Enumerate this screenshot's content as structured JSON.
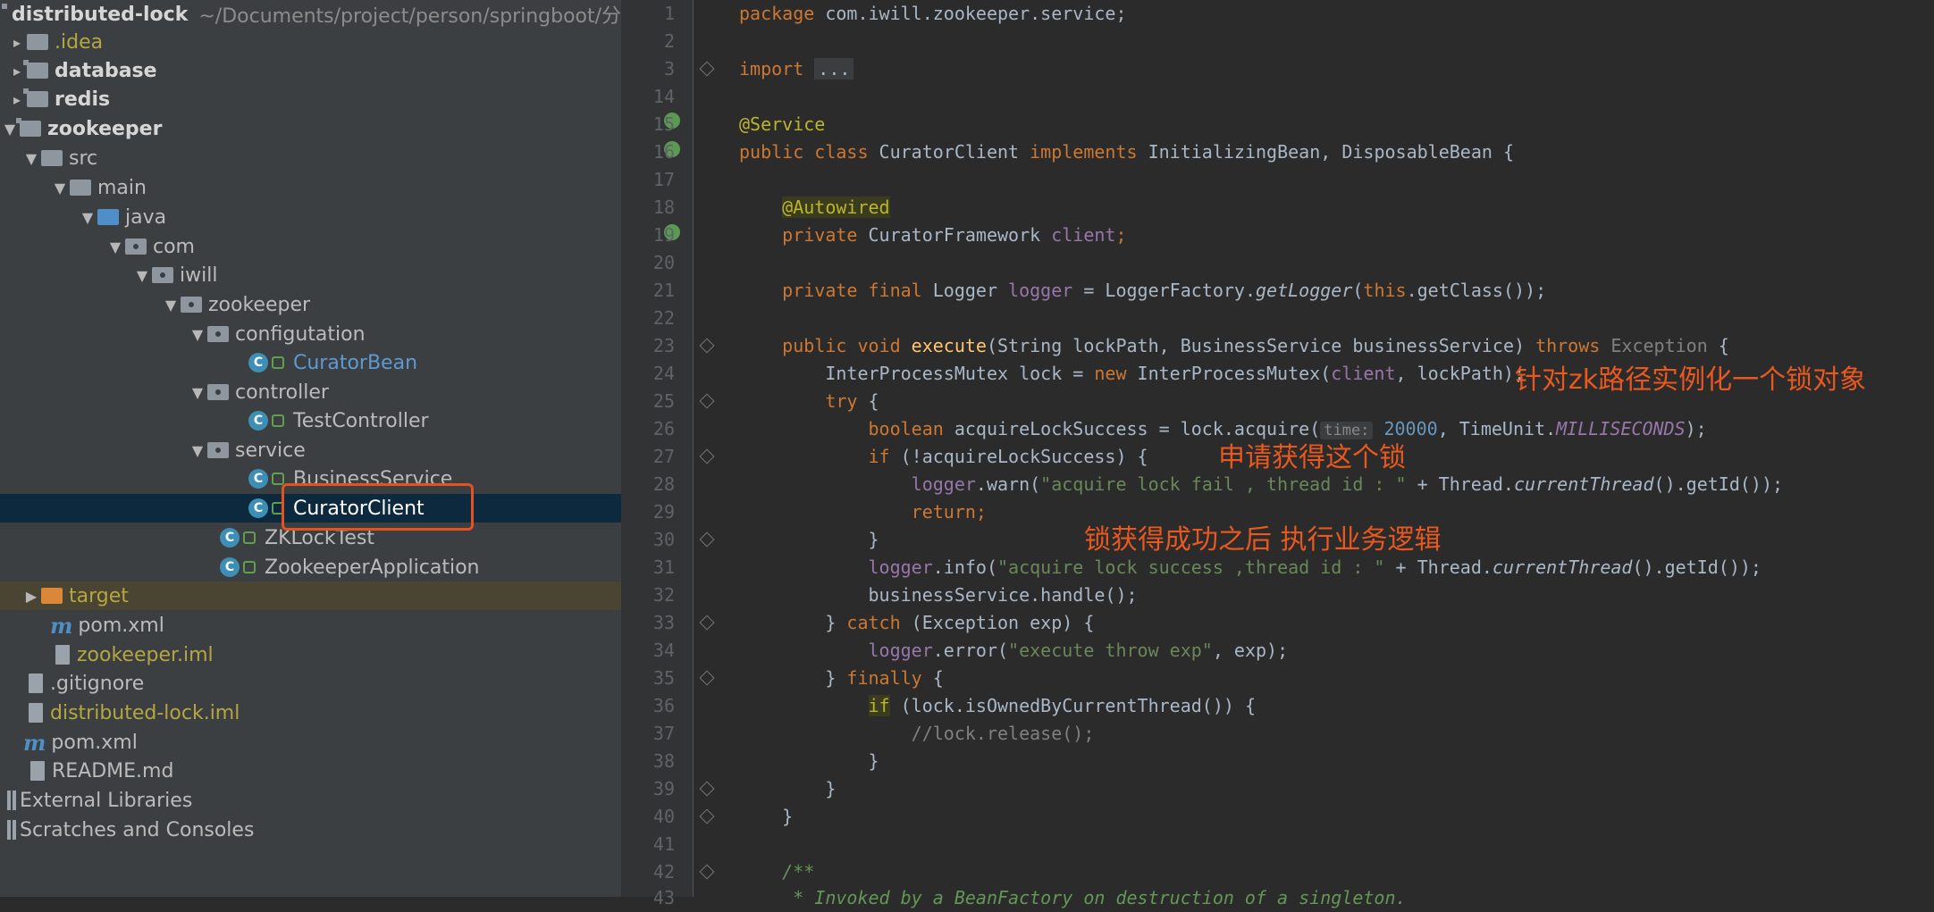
{
  "project": {
    "root_name": "distributed-lock",
    "root_path": "~/Documents/project/person/springboot/分布",
    "items": {
      "idea": ".idea",
      "database": "database",
      "redis": "redis",
      "zookeeper": "zookeeper",
      "src": "src",
      "main": "main",
      "java": "java",
      "com": "com",
      "iwill": "iwill",
      "zookeeper_pkg": "zookeeper",
      "configutation": "configutation",
      "curator_bean": "CuratorBean",
      "controller": "controller",
      "test_controller": "TestController",
      "service": "service",
      "business_service": "BusinessService",
      "curator_client": "CuratorClient",
      "zk_lock_test": "ZKLockTest",
      "zookeeper_application": "ZookeeperApplication",
      "target": "target",
      "pom_module": "pom.xml",
      "zookeeper_iml": "zookeeper.iml",
      "gitignore": ".gitignore",
      "distributed_iml": "distributed-lock.iml",
      "pom_root": "pom.xml",
      "readme": "README.md",
      "external_libraries": "External Libraries",
      "scratches": "Scratches and Consoles"
    }
  },
  "editor": {
    "line_numbers": [
      "1",
      "2",
      "3",
      "14",
      "15",
      "16",
      "17",
      "18",
      "19",
      "20",
      "21",
      "22",
      "23",
      "24",
      "25",
      "26",
      "27",
      "28",
      "29",
      "30",
      "31",
      "32",
      "33",
      "34",
      "35",
      "36",
      "37",
      "38",
      "39",
      "40",
      "41",
      "42",
      "43"
    ],
    "code": {
      "l1_kw": "package",
      "l1_rest": " com.iwill.zookeeper.service;",
      "l3_kw": "import",
      "l3_fold": "...",
      "l15": "@Service",
      "l16_kw1": "public class",
      "l16_name": "CuratorClient",
      "l16_kw2": "implements",
      "l16_rest": " InitializingBean, DisposableBean {",
      "l18": "@Autowired",
      "l19_kw": "private",
      "l19_type": " CuratorFramework ",
      "l19_field": "client",
      "l19_end": ";",
      "l21_kw": "private final",
      "l21_type": " Logger ",
      "l21_field": "logger",
      "l21_mid": " = LoggerFactory.",
      "l21_call": "getLogger",
      "l21_open": "(",
      "l21_this": "this",
      "l21_end": ".getClass());",
      "l23_kw": "public void",
      "l23_mth": "execute",
      "l23_params": "(String lockPath, BusinessService businessService) ",
      "l23_throws": "throws",
      "l23_exc": "Exception",
      "l23_end": " {",
      "l24_a": "InterProcessMutex lock = ",
      "l24_new": "new",
      "l24_b": " InterProcessMutex(",
      "l24_client": "client",
      "l24_c": ", lockPath);",
      "l25_kw": "try",
      "l25_end": " {",
      "l26_kw": "boolean",
      "l26_a": " acquireLockSuccess = lock.acquire(",
      "l26_hint": "time:",
      "l26_num": "20000",
      "l26_b": ", TimeUnit.",
      "l26_const": "MILLISECONDS",
      "l26_end": ");",
      "l27_kw": "if",
      "l27_rest": " (!acquireLockSuccess) {",
      "l28_field": "logger",
      "l28_a": ".warn(",
      "l28_str": "\"acquire lock fail , thread id : \"",
      "l28_b": " + Thread.",
      "l28_call": "currentThread",
      "l28_end": "().getId());",
      "l29_kw": "return",
      "l29_end": ";",
      "l30": "}",
      "l31_field": "logger",
      "l31_a": ".info(",
      "l31_str": "\"acquire lock success ,thread id : \"",
      "l31_b": " + Thread.",
      "l31_call": "currentThread",
      "l31_end": "().getId());",
      "l32": "businessService.handle();",
      "l33_a": "} ",
      "l33_kw": "catch",
      "l33_b": " (Exception exp) {",
      "l34_field": "logger",
      "l34_a": ".error(",
      "l34_str": "\"execute throw exp\"",
      "l34_end": ", exp);",
      "l35_a": "} ",
      "l35_kw": "finally",
      "l35_end": " {",
      "l36_kw": "if",
      "l36_rest": " (lock.isOwnedByCurrentThread()) {",
      "l37": "//lock.release();",
      "l38": "}",
      "l39": "}",
      "l40": "}",
      "l42": "/**",
      "l43": " * Invoked by a BeanFactory on destruction of a singleton."
    }
  },
  "annotations": {
    "note1": "针对zk路径实例化一个锁对象",
    "note2": "申请获得这个锁",
    "note3": "锁获得成功之后 执行业务逻辑"
  },
  "colors": {
    "highlight": "#e4521f",
    "annotation_text": "#e8581f",
    "selection": "#0d293e"
  }
}
